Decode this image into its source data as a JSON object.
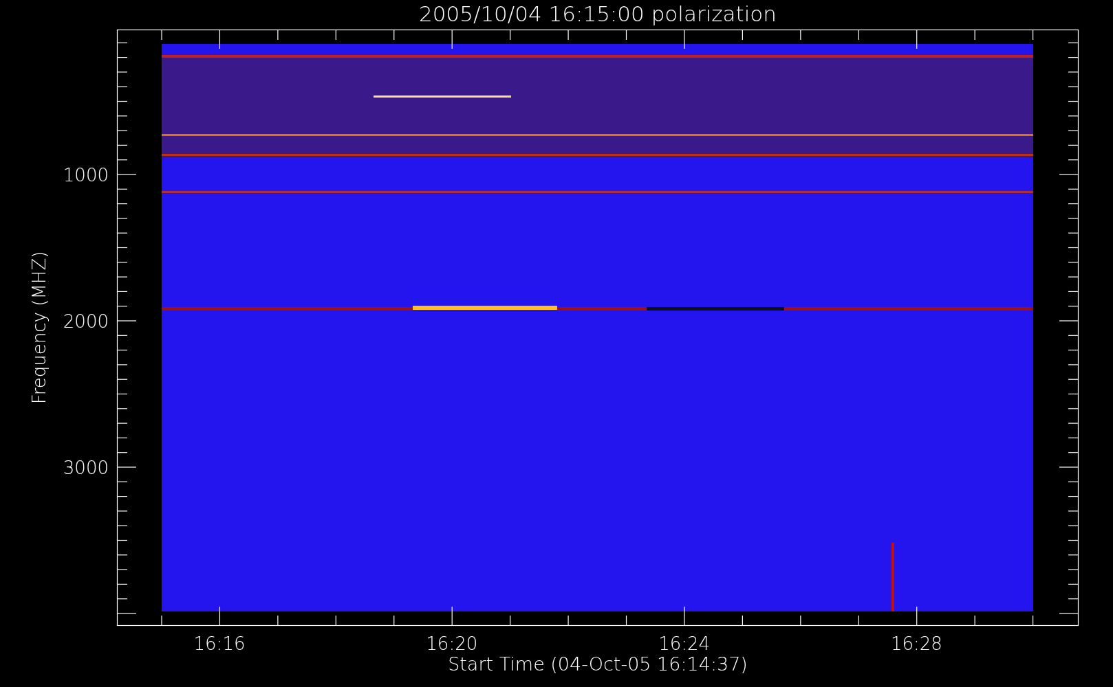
{
  "title": "2005/10/04 16:15:00 polarization",
  "plot": {
    "ylabel": "Frequency (MHZ)",
    "xlabel": "Start Time (04-Oct-05 16:14:37)",
    "yticks": [
      "1000",
      "2000",
      "3000"
    ],
    "xticks": [
      "16:16",
      "16:20",
      "16:24",
      "16:28"
    ]
  }
}
